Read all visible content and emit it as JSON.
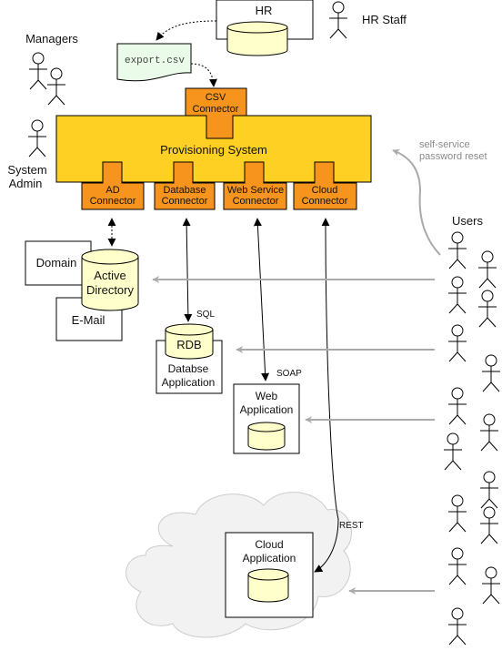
{
  "diagram": {
    "hr": {
      "system_label": "HR",
      "actor_label": "HR Staff"
    },
    "export_file": {
      "label": "export.csv"
    },
    "actors": {
      "managers": "Managers",
      "system_admin_line1": "System",
      "system_admin_line2": "Admin",
      "users": "Users"
    },
    "provisioning": {
      "title": "Provisioning System",
      "csv_connector": [
        "CSV",
        "Connector"
      ],
      "connectors": [
        {
          "line1": "AD",
          "line2": "Connector"
        },
        {
          "line1": "Database",
          "line2": "Connector"
        },
        {
          "line1": "Web Service",
          "line2": "Connector"
        },
        {
          "line1": "Cloud",
          "line2": "Connector"
        }
      ]
    },
    "self_service": {
      "line1": "self-service",
      "line2": "password reset"
    },
    "targets": {
      "domain": "Domain",
      "email": "E-Mail",
      "active_directory": [
        "Active",
        "Directory"
      ],
      "rdb": "RDB",
      "db_app": [
        "Databse",
        "Application"
      ],
      "web_app": [
        "Web",
        "Application"
      ],
      "cloud_app": [
        "Cloud",
        "Application"
      ]
    },
    "protocols": {
      "sql": "SQL",
      "soap": "SOAP",
      "rest": "REST"
    },
    "colors": {
      "provisioning_fill": "#FDD023",
      "connector_fill": "#F7941D",
      "database_fill": "#FFFFCC",
      "file_fill": "#EAFBE9",
      "cloud_fill": "#F2F2F2",
      "user_arrow": "#AAAAAA"
    }
  }
}
